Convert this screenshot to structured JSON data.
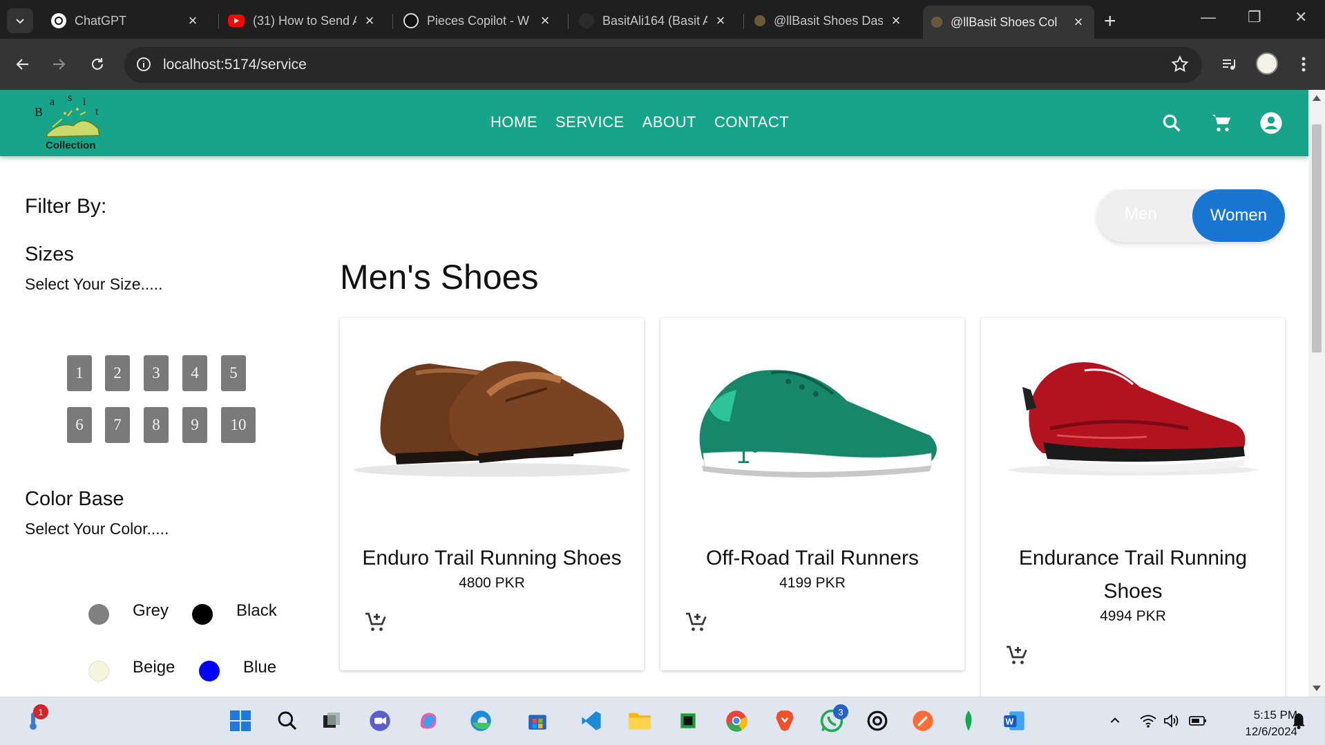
{
  "browser": {
    "tabs": [
      {
        "title": "ChatGPT",
        "icon": "chatgpt-icon",
        "active": false
      },
      {
        "title": "(31) How to Send A",
        "icon": "youtube-icon",
        "active": false
      },
      {
        "title": "Pieces Copilot - W",
        "icon": "pieces-icon",
        "active": false
      },
      {
        "title": "BasitAli164 (Basit A",
        "icon": "github-icon",
        "active": false
      },
      {
        "title": "@llBasit Shoes Das",
        "icon": "shoe-favicon",
        "active": false
      },
      {
        "title": "@llBasit Shoes Col",
        "icon": "shoe-favicon",
        "active": true
      }
    ],
    "url": "localhost:5174/service"
  },
  "site": {
    "logo_caption": "Collection",
    "logo_letters": "Basit",
    "nav": [
      "HOME",
      "SERVICE",
      "ABOUT",
      "CONTACT"
    ],
    "accent": "#17a589"
  },
  "filters": {
    "title": "Filter By:",
    "sizes_title": "Sizes",
    "sizes_sub": "Select Your Size.....",
    "sizes": [
      "1",
      "2",
      "3",
      "4",
      "5",
      "6",
      "7",
      "8",
      "9",
      "10"
    ],
    "colors_title": "Color Base",
    "colors_sub": "Select Your Color.....",
    "colors": [
      {
        "name": "Grey",
        "hex": "#808080"
      },
      {
        "name": "Black",
        "hex": "#000000"
      },
      {
        "name": "Beige",
        "hex": "#f5f5dc"
      },
      {
        "name": "Blue",
        "hex": "#0000ff"
      }
    ]
  },
  "toggle": {
    "men": "Men",
    "women": "Women",
    "selected": "Women"
  },
  "section_title": "Men's Shoes",
  "products": [
    {
      "name": "Enduro Trail Running Shoes",
      "price": "4800 PKR",
      "image": "brown-loafer"
    },
    {
      "name": "Off-Road Trail Runners",
      "price": "4199 PKR",
      "image": "green-sneaker"
    },
    {
      "name": "Endurance Trail Running Shoes",
      "price": "4994 PKR",
      "image": "red-runner"
    }
  ],
  "taskbar": {
    "time": "5:15 PM",
    "date": "12/6/2024",
    "weather_badge": "1",
    "whatsapp_badge": "3"
  }
}
